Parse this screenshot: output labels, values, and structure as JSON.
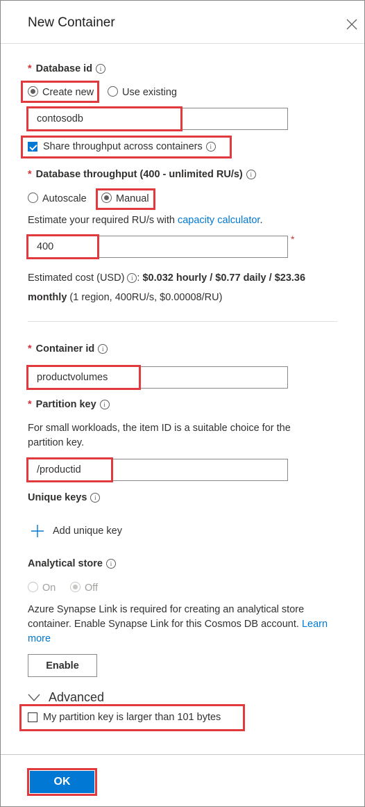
{
  "panel": {
    "title": "New Container"
  },
  "database": {
    "label": "Database id",
    "create_new": "Create new",
    "use_existing": "Use existing",
    "id_value": "contosodb",
    "share_throughput": "Share throughput across containers"
  },
  "throughput": {
    "label": "Database throughput (400 - unlimited RU/s)",
    "autoscale": "Autoscale",
    "manual": "Manual",
    "estimate_prefix": "Estimate your required RU/s with ",
    "estimate_link": "capacity calculator",
    "estimate_suffix": ".",
    "value": "400",
    "cost_prefix": "Estimated cost (USD) ",
    "cost_colon": ": ",
    "cost_bold_1": "$0.032 hourly / $0.77 daily / $23.36",
    "cost_bold_2": "monthly",
    "cost_suffix": " (1 region, 400RU/s, $0.00008/RU)"
  },
  "container": {
    "label": "Container id",
    "value": "productvolumes"
  },
  "partition": {
    "label": "Partition key",
    "help_line1": "For small workloads, the item ID is a suitable choice for the",
    "help_line2": "partition key.",
    "value": "/productid"
  },
  "unique_keys": {
    "label": "Unique keys",
    "add": "Add unique key"
  },
  "analytical": {
    "label": "Analytical store",
    "on": "On",
    "off": "Off",
    "note_line1": "Azure Synapse Link is required for creating an analytical store",
    "note_line2": "container. Enable Synapse Link for this Cosmos DB account. ",
    "note_link_1": "Learn",
    "note_link_2": "more",
    "enable_button": "Enable"
  },
  "advanced": {
    "label": "Advanced",
    "large_key": "My partition key is larger than 101 bytes"
  },
  "footer": {
    "ok": "OK"
  },
  "symbols": {
    "asterisk": "*",
    "info": "i"
  },
  "colors": {
    "accent": "#0078d4",
    "highlight": "#e03a3e",
    "required": "#d13438"
  }
}
